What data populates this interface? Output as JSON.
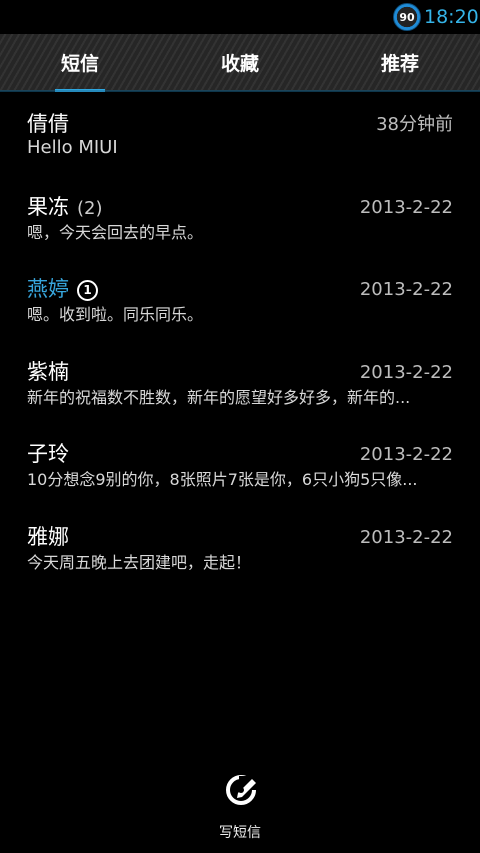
{
  "status_bar": {
    "battery_level": "90",
    "time": "18:20",
    "accent_color": "#35b4e8"
  },
  "tabs": [
    {
      "label": "短信",
      "active": true
    },
    {
      "label": "收藏",
      "active": false
    },
    {
      "label": "推荐",
      "active": false
    }
  ],
  "messages": [
    {
      "name": "倩倩",
      "count": "",
      "unread": false,
      "unread_badge": "",
      "time": "38分钟前",
      "preview": "Hello MIUI"
    },
    {
      "name": "果冻",
      "count": "(2)",
      "unread": false,
      "unread_badge": "",
      "time": "2013-2-22",
      "preview": "嗯，今天会回去的早点。"
    },
    {
      "name": "燕婷",
      "count": "",
      "unread": true,
      "unread_badge": "1",
      "time": "2013-2-22",
      "preview": "嗯。收到啦。同乐同乐。"
    },
    {
      "name": "紫楠",
      "count": "",
      "unread": false,
      "unread_badge": "",
      "time": "2013-2-22",
      "preview": "新年的祝福数不胜数，新年的愿望好多好多，新年的..."
    },
    {
      "name": "子玲",
      "count": "",
      "unread": false,
      "unread_badge": "",
      "time": "2013-2-22",
      "preview": "10分想念9别的你，8张照片7张是你，6只小狗5只像..."
    },
    {
      "name": "雅娜",
      "count": "",
      "unread": false,
      "unread_badge": "",
      "time": "2013-2-22",
      "preview": "今天周五晚上去团建吧，走起！"
    }
  ],
  "compose": {
    "label": "写短信",
    "icon": "compose-icon"
  },
  "colors": {
    "accent": "#2ea7e0",
    "unread_name": "#37a6dd",
    "background": "#000000"
  }
}
